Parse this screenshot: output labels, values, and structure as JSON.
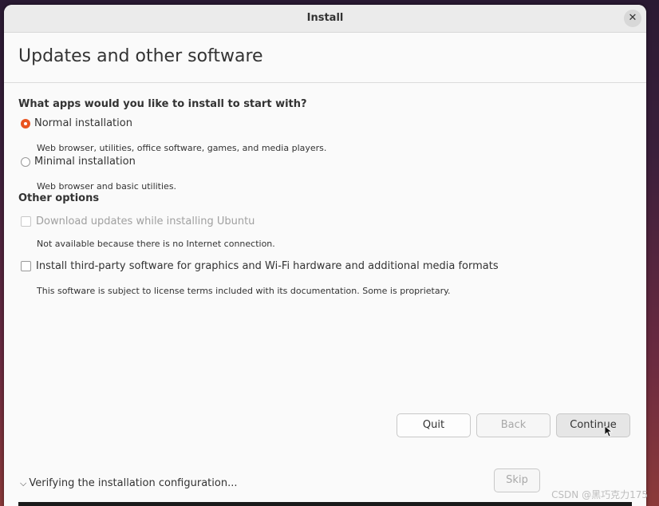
{
  "window": {
    "title": "Install",
    "close_symbol": "✕"
  },
  "header": {
    "title": "Updates and other software"
  },
  "apps": {
    "question": "What apps would you like to install to start with?",
    "normal": {
      "label": "Normal installation",
      "desc": "Web browser, utilities, office software, games, and media players.",
      "selected": true
    },
    "minimal": {
      "label": "Minimal installation",
      "desc": "Web browser and basic utilities.",
      "selected": false
    }
  },
  "other": {
    "heading": "Other options",
    "download_updates": {
      "label": "Download updates while installing Ubuntu",
      "desc": "Not available because there is no Internet connection.",
      "disabled": true,
      "checked": false
    },
    "third_party": {
      "label": "Install third-party software for graphics and Wi-Fi hardware and additional media formats",
      "desc": "This software is subject to license terms included with its documentation. Some is proprietary.",
      "checked": false
    }
  },
  "buttons": {
    "quit": "Quit",
    "back": "Back",
    "continue": "Continue",
    "skip": "Skip"
  },
  "progress": {
    "chevron": "⌵",
    "label": "Verifying the installation configuration..."
  },
  "watermark": "CSDN @黑巧克力175",
  "colors": {
    "accent": "#e95420"
  }
}
